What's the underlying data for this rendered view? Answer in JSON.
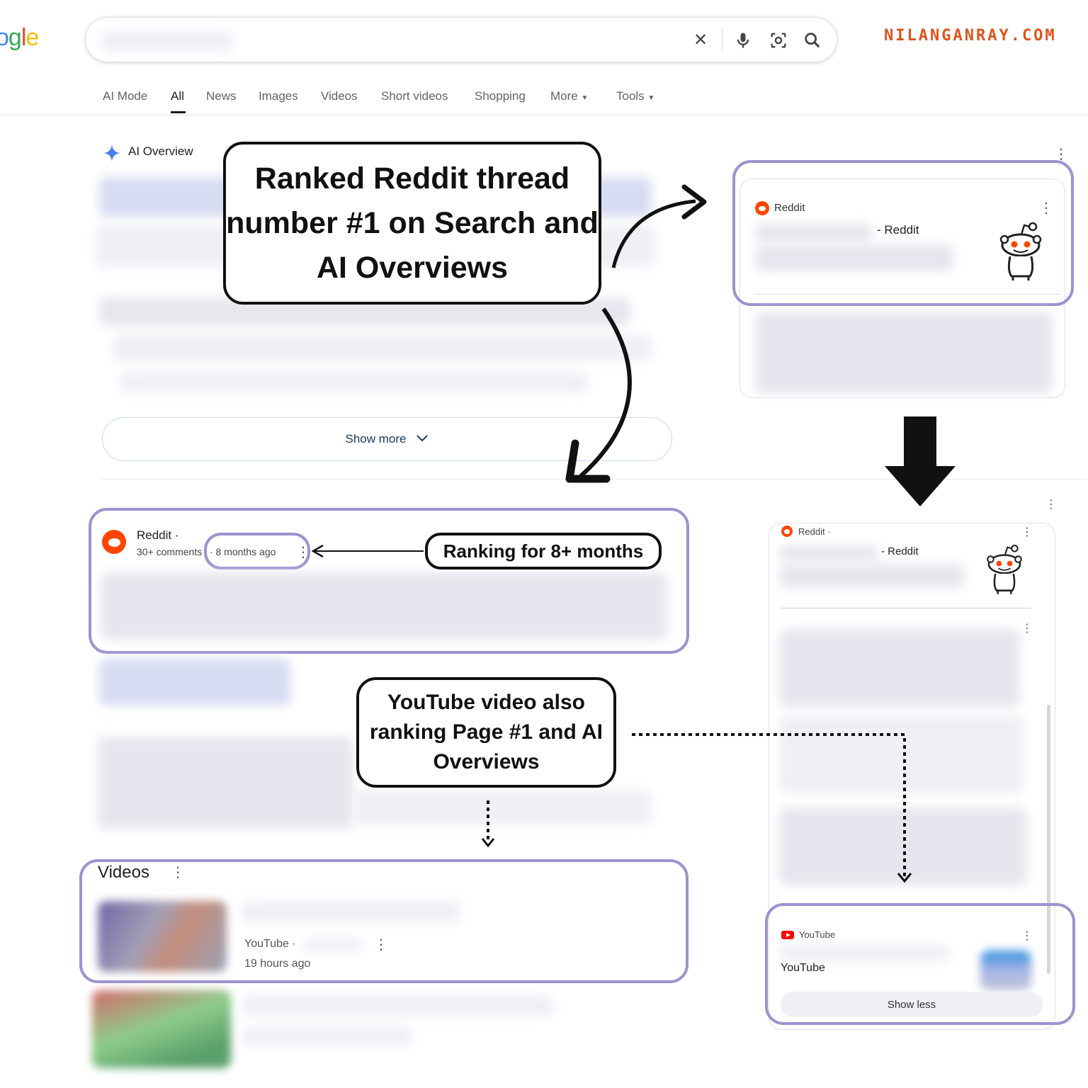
{
  "header": {
    "logo_text": "ogle",
    "brand": "NILANGANRAY.COM",
    "tabs": [
      "AI Mode",
      "All",
      "News",
      "Images",
      "Videos",
      "Short videos",
      "Shopping",
      "More",
      "Tools"
    ],
    "active_tab": "All"
  },
  "ai_overview": {
    "label": "AI Overview",
    "show_more": "Show more"
  },
  "callouts": {
    "ranked": "Ranked Reddit thread number #1 on Search and AI Overviews",
    "months": "Ranking for 8+ months",
    "youtube": "YouTube video also ranking Page #1 and AI Overviews"
  },
  "ai_side": {
    "source": "Reddit",
    "title_suffix": "- Reddit"
  },
  "result": {
    "source": "Reddit ·",
    "comments": "30+ comments",
    "age": "· 8 months ago"
  },
  "videos": {
    "title": "Videos",
    "source": "YouTube ·",
    "age": "19 hours ago"
  },
  "side_panel": {
    "source": "Reddit ·",
    "title_suffix": "- Reddit",
    "yt_source": "YouTube",
    "yt_title": "YouTube",
    "show_less": "Show less"
  },
  "colors": {
    "highlight": "#9e92cf",
    "brand": "#e0531a",
    "reddit": "#ff4500",
    "youtube": "#ff0000"
  }
}
